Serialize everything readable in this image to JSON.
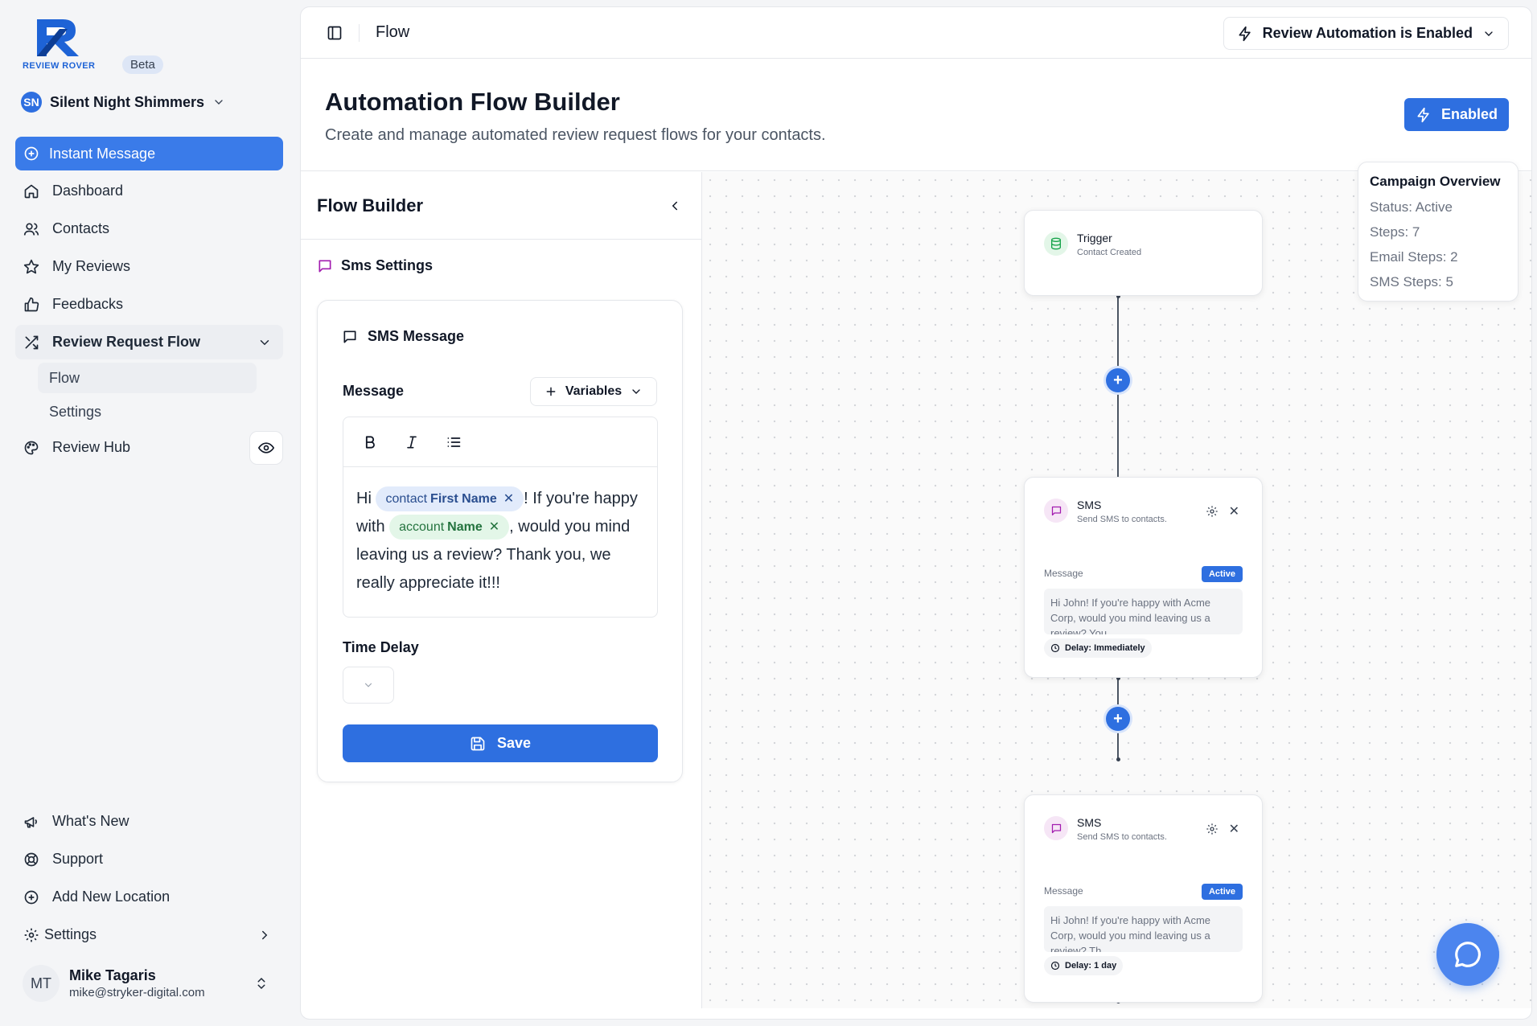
{
  "brand": {
    "logo_text": "REVIEW ROVER",
    "beta": "Beta",
    "accent": "#2e6fe0"
  },
  "org": {
    "initials": "SN",
    "name": "Silent Night Shimmers"
  },
  "nav": {
    "instant_message": "Instant Message",
    "dashboard": "Dashboard",
    "contacts": "Contacts",
    "my_reviews": "My Reviews",
    "feedbacks": "Feedbacks",
    "review_request_flow": "Review Request Flow",
    "sub_flow": "Flow",
    "sub_settings": "Settings",
    "review_hub": "Review Hub",
    "whats_new": "What's New",
    "support": "Support",
    "add_location": "Add New Location",
    "settings": "Settings"
  },
  "user": {
    "initials": "MT",
    "name": "Mike Tagaris",
    "email": "mike@stryker-digital.com"
  },
  "topbar": {
    "breadcrumb": "Flow",
    "automation_status": "Review Automation is Enabled"
  },
  "header": {
    "title": "Automation Flow Builder",
    "subtitle": "Create and manage automated review request flows for your contacts.",
    "enabled_button": "Enabled"
  },
  "builder": {
    "title": "Flow Builder",
    "section": "Sms Settings",
    "card_title": "SMS Message",
    "message_label": "Message",
    "variables_button": "Variables",
    "message": {
      "part1": "Hi ",
      "chip1_prefix": "contact",
      "chip1_name": "First Name",
      "part2": "! If you're happy with ",
      "chip2_prefix": "account",
      "chip2_name": "Name",
      "part3": ", would you mind leaving us a review? Thank you, we really appreciate it!!!"
    },
    "time_delay_label": "Time Delay",
    "save_button": "Save"
  },
  "flow": {
    "trigger": {
      "title": "Trigger",
      "desc": "Contact Created"
    },
    "nodes": [
      {
        "title": "SMS",
        "desc": "Send SMS to contacts.",
        "msg_label": "Message",
        "status": "Active",
        "preview": "Hi John! If you're happy with Acme Corp, would you mind leaving us a review? You",
        "delay": "Delay: Immediately"
      },
      {
        "title": "SMS",
        "desc": "Send SMS to contacts.",
        "msg_label": "Message",
        "status": "Active",
        "preview": "Hi John! If you're happy with Acme Corp, would you mind leaving us a review? Th",
        "delay": "Delay: 1 day"
      }
    ]
  },
  "overview": {
    "title": "Campaign Overview",
    "status": "Status: Active",
    "steps": "Steps: 7",
    "email_steps": "Email Steps: 2",
    "sms_steps": "SMS Steps: 5"
  }
}
